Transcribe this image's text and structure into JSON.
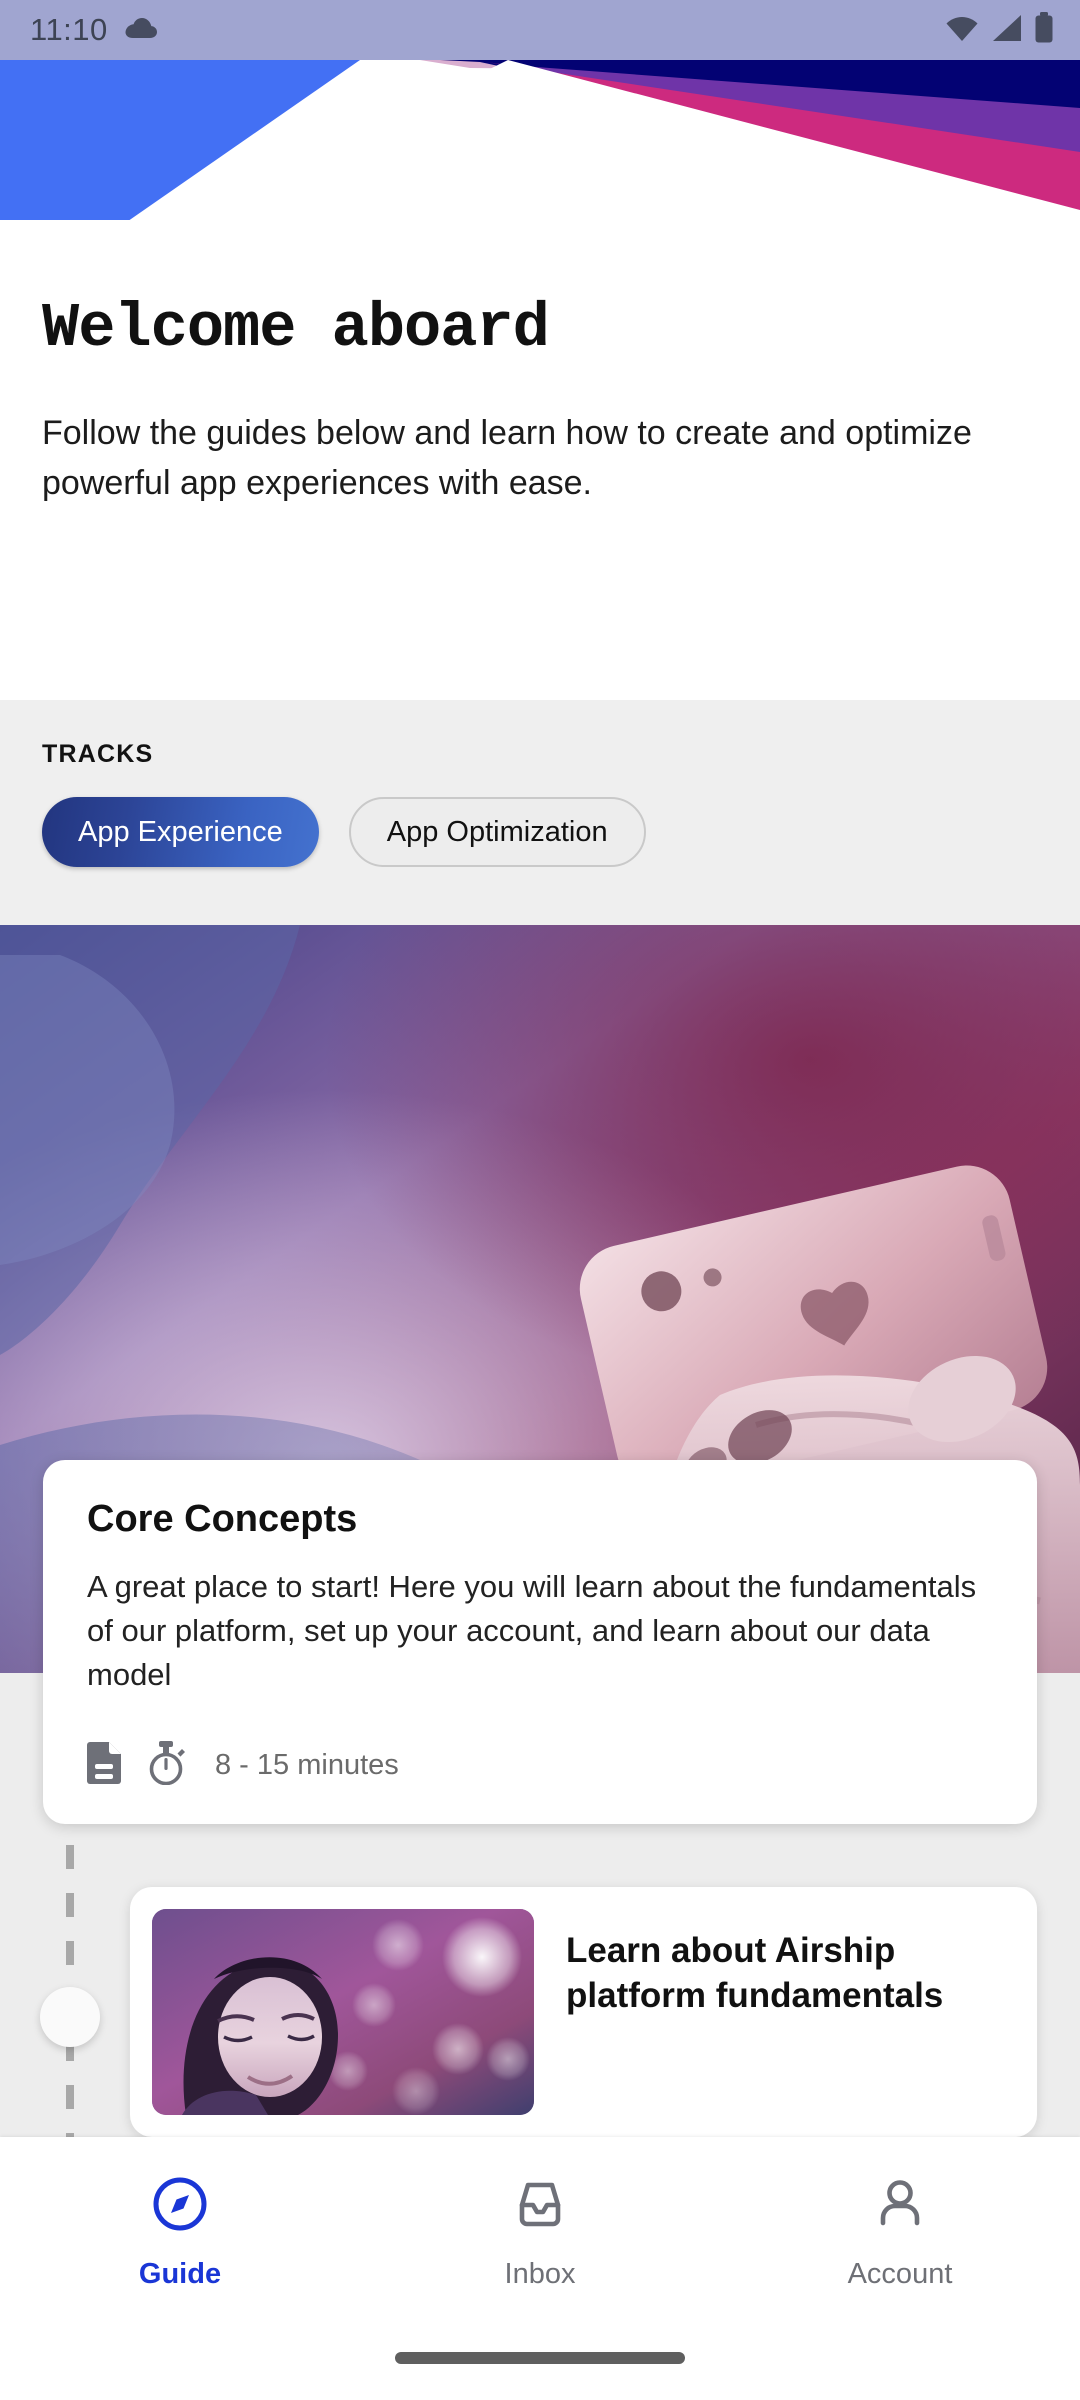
{
  "status_bar": {
    "time": "11:10",
    "icons": [
      "cloud-icon",
      "wifi-icon",
      "cellular-signal-icon",
      "battery-icon"
    ]
  },
  "header": {
    "title": "Welcome aboard",
    "subtitle": "Follow the guides below and learn how to create and optimize powerful app experiences with ease."
  },
  "tracks": {
    "label": "TRACKS",
    "chips": [
      {
        "label": "App Experience",
        "selected": true
      },
      {
        "label": "App Optimization",
        "selected": false
      }
    ]
  },
  "concept_card": {
    "title": "Core Concepts",
    "body": "A great place to start! Here you will learn about the fundamentals of our platform, set up your account, and learn about our data model",
    "doc_icon": "document-icon",
    "time_icon": "stopwatch-icon",
    "duration": "8 - 15 minutes"
  },
  "lesson_card": {
    "title": "Learn about Airship platform fundamentals",
    "thumbnail_alt": "woman-looking-at-screen-thumbnail"
  },
  "bottom_nav": [
    {
      "label": "Guide",
      "icon": "compass-icon",
      "active": true
    },
    {
      "label": "Inbox",
      "icon": "inbox-icon",
      "active": false
    },
    {
      "label": "Account",
      "icon": "person-icon",
      "active": false
    }
  ],
  "colors": {
    "accent_blue": "#1a36d6",
    "chip_gradient_start": "#22357f",
    "chip_gradient_end": "#4472cf",
    "status_bar_bg": "#a0a5d0",
    "surface_grey": "#ededed",
    "inactive_grey": "#6e7076"
  }
}
